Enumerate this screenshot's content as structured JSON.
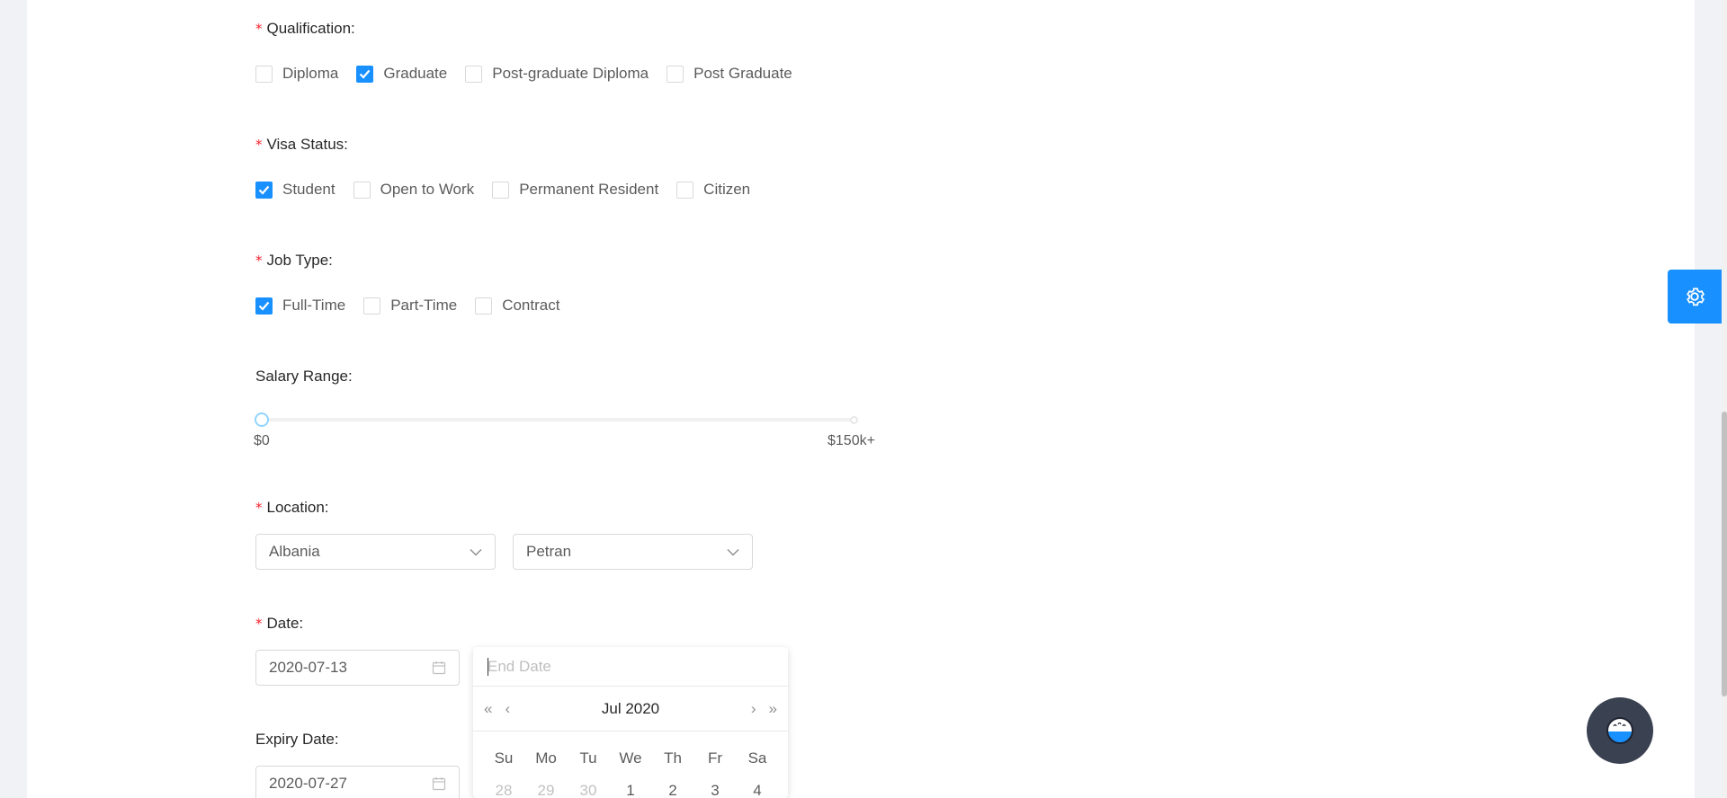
{
  "qualification": {
    "label": "Qualification:",
    "options": [
      {
        "label": "Diploma",
        "checked": false
      },
      {
        "label": "Graduate",
        "checked": true
      },
      {
        "label": "Post-graduate Diploma",
        "checked": false
      },
      {
        "label": "Post Graduate",
        "checked": false
      }
    ]
  },
  "visa": {
    "label": "Visa Status:",
    "options": [
      {
        "label": "Student",
        "checked": true
      },
      {
        "label": "Open to Work",
        "checked": false
      },
      {
        "label": "Permanent Resident",
        "checked": false
      },
      {
        "label": "Citizen",
        "checked": false
      }
    ]
  },
  "job_type": {
    "label": "Job Type:",
    "options": [
      {
        "label": "Full-Time",
        "checked": true
      },
      {
        "label": "Part-Time",
        "checked": false
      },
      {
        "label": "Contract",
        "checked": false
      }
    ]
  },
  "salary": {
    "label": "Salary Range:",
    "min_label": "$0",
    "max_label": "$150k+",
    "value_fraction": 0
  },
  "location": {
    "label": "Location:",
    "country": "Albania",
    "city": "Petran"
  },
  "date": {
    "label": "Date:",
    "start": "2020-07-13",
    "end_placeholder": "End Date"
  },
  "calendar": {
    "title": "Jul 2020",
    "nav_prev_year": "«",
    "nav_prev_month": "‹",
    "nav_next_month": "›",
    "nav_next_year": "»",
    "weekdays": [
      "Su",
      "Mo",
      "Tu",
      "We",
      "Th",
      "Fr",
      "Sa"
    ],
    "first_row": [
      {
        "d": "28",
        "muted": true
      },
      {
        "d": "29",
        "muted": true
      },
      {
        "d": "30",
        "muted": true
      },
      {
        "d": "1",
        "muted": false
      },
      {
        "d": "2",
        "muted": false
      },
      {
        "d": "3",
        "muted": false
      },
      {
        "d": "4",
        "muted": false
      }
    ]
  },
  "expiry": {
    "label": "Expiry Date:",
    "value": "2020-07-27"
  },
  "colors": {
    "primary": "#1890ff",
    "required": "#f5222d",
    "fab": "#3a4150"
  },
  "icons": {
    "settings": "gear-icon",
    "fab": "chat-bot-icon",
    "calendar": "calendar-icon",
    "dropdown": "chevron-down-icon",
    "check": "check-icon"
  }
}
